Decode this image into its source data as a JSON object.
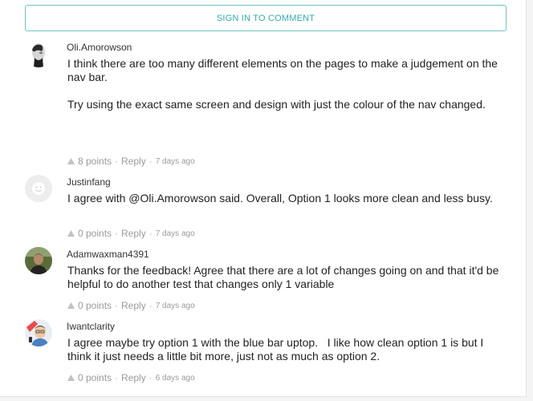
{
  "signin_label": "SIGN IN TO COMMENT",
  "comments": [
    {
      "author": "Oli.Amorowson",
      "paragraphs": [
        "I think there are too many different elements on the pages to make a judgement on the nav bar.",
        "Try using the exact same screen and design with just the colour of the nav changed."
      ],
      "points": "8 points",
      "reply": "Reply",
      "time": "7 days ago"
    },
    {
      "author": "Justinfang",
      "paragraphs": [
        "I agree with @Oli.Amorowson said. Overall, Option 1 looks more clean and less busy."
      ],
      "points": "0 points",
      "reply": "Reply",
      "time": "7 days ago"
    },
    {
      "author": "Adamwaxman4391",
      "paragraphs": [
        "Thanks for the feedback! Agree that there are a lot of changes going on and that it'd be helpful to do another test that changes only 1 variable"
      ],
      "points": "0 points",
      "reply": "Reply",
      "time": "7 days ago"
    },
    {
      "author": "Iwantclarity",
      "paragraphs": [
        "I agree maybe try option 1 with the blue bar uptop.   I like how clean option 1 is but I think it just needs a little bit more, just not as much as option 2."
      ],
      "points": "0 points",
      "reply": "Reply",
      "time": "6 days ago"
    }
  ],
  "colors": {
    "accent": "#36a9ad",
    "meta_text": "#9a9a9a"
  },
  "icons": {
    "upvote": "upvote-triangle-icon",
    "separator": "·"
  }
}
